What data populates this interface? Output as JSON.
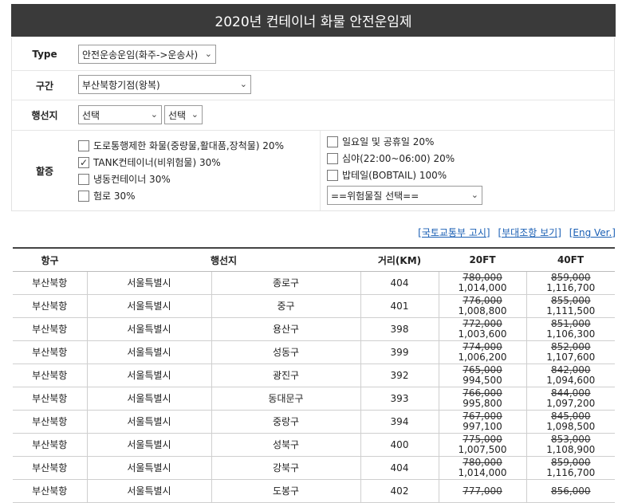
{
  "title": "2020년 컨테이너 화물 안전운임제",
  "form": {
    "type_label": "Type",
    "type_value": "안전운송운임(화주->운송사)",
    "section_label": "구간",
    "section_value": "부산북항기점(왕복)",
    "dest_label": "행선지",
    "dest_value1": "선택",
    "dest_value2": "선택",
    "surcharge_label": "할증",
    "options_left": [
      {
        "label": "도로통행제한 화물(중량물,활대품,장척물) 20%",
        "checked": false
      },
      {
        "label": "TANK컨테이너(비위험물) 30%",
        "checked": true
      },
      {
        "label": "냉동컨테이너 30%",
        "checked": false
      },
      {
        "label": "험로 30%",
        "checked": false
      }
    ],
    "options_right": [
      {
        "label": "일요일 및 공휴일 20%",
        "checked": false
      },
      {
        "label": "심야(22:00~06:00) 20%",
        "checked": false
      },
      {
        "label": "밥테일(BOBTAIL) 100%",
        "checked": false
      }
    ],
    "hazard_value": "==위험물질 선택=="
  },
  "links": [
    "[국토교통부 고시]",
    "[부대조항 보기]",
    "[Eng Ver.]"
  ],
  "table": {
    "headers": {
      "port": "항구",
      "dest": "행선지",
      "dist": "거리(KM)",
      "ft20": "20FT",
      "ft40": "40FT"
    },
    "rows": [
      {
        "port": "부산북항",
        "city": "서울특별시",
        "district": "종로구",
        "dist": "404",
        "old20": "780,000",
        "new20": "1,014,000",
        "old40": "859,000",
        "new40": "1,116,700"
      },
      {
        "port": "부산북항",
        "city": "서울특별시",
        "district": "중구",
        "dist": "401",
        "old20": "776,000",
        "new20": "1,008,800",
        "old40": "855,000",
        "new40": "1,111,500"
      },
      {
        "port": "부산북항",
        "city": "서울특별시",
        "district": "용산구",
        "dist": "398",
        "old20": "772,000",
        "new20": "1,003,600",
        "old40": "851,000",
        "new40": "1,106,300"
      },
      {
        "port": "부산북항",
        "city": "서울특별시",
        "district": "성동구",
        "dist": "399",
        "old20": "774,000",
        "new20": "1,006,200",
        "old40": "852,000",
        "new40": "1,107,600"
      },
      {
        "port": "부산북항",
        "city": "서울특별시",
        "district": "광진구",
        "dist": "392",
        "old20": "765,000",
        "new20": "994,500",
        "old40": "842,000",
        "new40": "1,094,600"
      },
      {
        "port": "부산북항",
        "city": "서울특별시",
        "district": "동대문구",
        "dist": "393",
        "old20": "766,000",
        "new20": "995,800",
        "old40": "844,000",
        "new40": "1,097,200"
      },
      {
        "port": "부산북항",
        "city": "서울특별시",
        "district": "중랑구",
        "dist": "394",
        "old20": "767,000",
        "new20": "997,100",
        "old40": "845,000",
        "new40": "1,098,500"
      },
      {
        "port": "부산북항",
        "city": "서울특별시",
        "district": "성북구",
        "dist": "400",
        "old20": "775,000",
        "new20": "1,007,500",
        "old40": "853,000",
        "new40": "1,108,900"
      },
      {
        "port": "부산북항",
        "city": "서울특별시",
        "district": "강북구",
        "dist": "404",
        "old20": "780,000",
        "new20": "1,014,000",
        "old40": "859,000",
        "new40": "1,116,700"
      },
      {
        "port": "부산북항",
        "city": "서울특별시",
        "district": "도봉구",
        "dist": "402",
        "old20": "777,000",
        "new20": "",
        "old40": "856,000",
        "new40": ""
      }
    ]
  }
}
